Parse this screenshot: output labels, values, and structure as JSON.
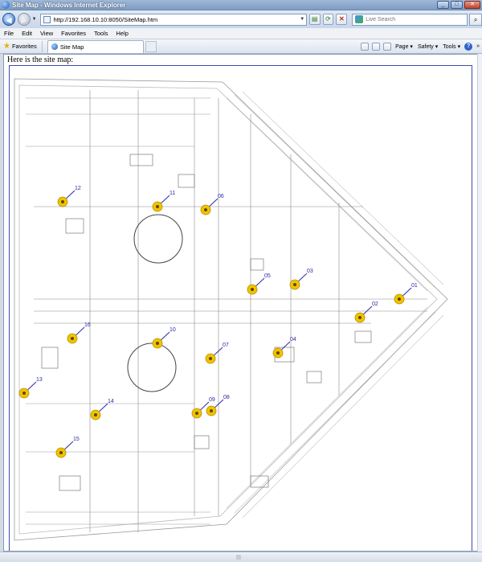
{
  "window": {
    "title": "Site Map - Windows Internet Explorer",
    "minimize": "_",
    "maximize": "□",
    "close": "✕"
  },
  "address": {
    "url": "http://192.168.10.10:8050/SiteMap.htm",
    "search_placeholder": "Live Search"
  },
  "nav": {
    "back": "◀",
    "forward": "▶"
  },
  "menu": [
    "File",
    "Edit",
    "View",
    "Favorites",
    "Tools",
    "Help"
  ],
  "favorites_label": "Favorites",
  "tab": {
    "label": "Site Map"
  },
  "commands": [
    "Page",
    "Safety",
    "Tools"
  ],
  "page": {
    "intro": "Here is the site map:"
  },
  "markers": [
    "01",
    "02",
    "03",
    "04",
    "05",
    "06",
    "07",
    "08",
    "09",
    "10",
    "11",
    "12",
    "13",
    "14",
    "15",
    "16"
  ],
  "colors": {
    "marker": "#f2c200",
    "marker_label": "#2a2aa8",
    "frame_border": "#3e4cb0"
  }
}
